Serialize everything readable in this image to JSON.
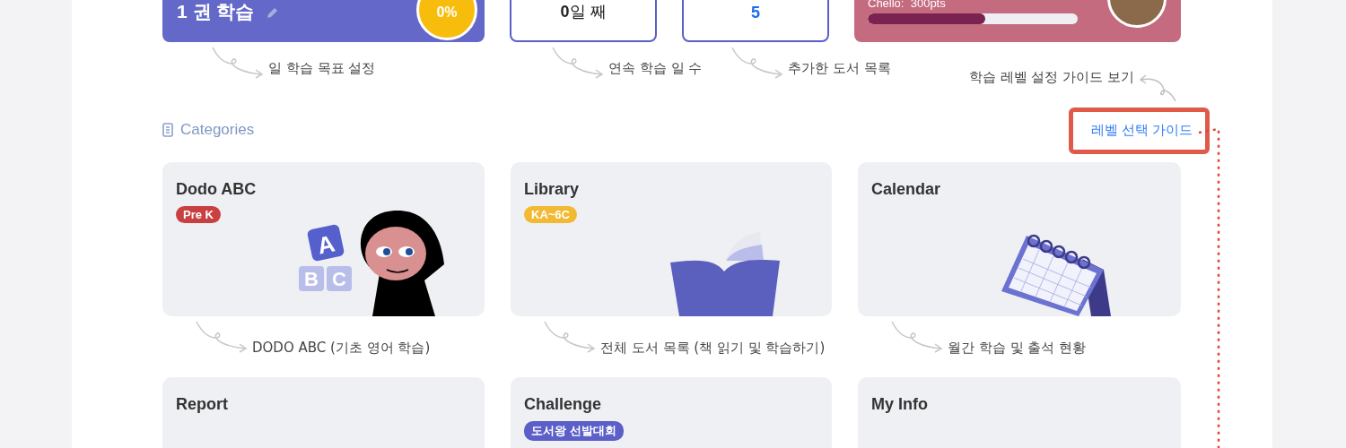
{
  "summary_cards": [
    {
      "kind": "goal",
      "value": "1 권 학습",
      "percent": "0%",
      "annotation": "일 학습 목표 설정"
    },
    {
      "kind": "streak",
      "value": "**0**일 째",
      "annotation": "연속 학습 일 수"
    },
    {
      "kind": "books",
      "value": "5",
      "annotation": "추가한 도서 목록"
    },
    {
      "kind": "level",
      "text": "Chello:  300pts",
      "level": 0.56,
      "annotation": "학습 레벨 설정 가이드 보기"
    }
  ],
  "section": {
    "title": "Categories",
    "guide_button": "레벨 선택 가이드"
  },
  "categories": [
    {
      "title": "Dodo ABC",
      "badge": {
        "text": "Pre K",
        "color": "#c94040"
      },
      "kind": "character",
      "blocks": [
        "A",
        "B",
        "C"
      ],
      "annotation": "DODO ABC (기초 영어 학습)"
    },
    {
      "title": "Library",
      "badge": {
        "text": "KA~6C",
        "color": "#f2b933"
      },
      "kind": "book",
      "annotation": "전체 도서 목록 (책 읽기 및 학습하기)"
    },
    {
      "title": "Calendar",
      "kind": "calendar",
      "annotation": "월간 학습 및 출석 현황"
    },
    {
      "title": "Report"
    },
    {
      "title": "Challenge",
      "badge": {
        "text": "도서왕 선발대회",
        "color": "#5b5fc7"
      }
    },
    {
      "title": "My Info"
    }
  ]
}
